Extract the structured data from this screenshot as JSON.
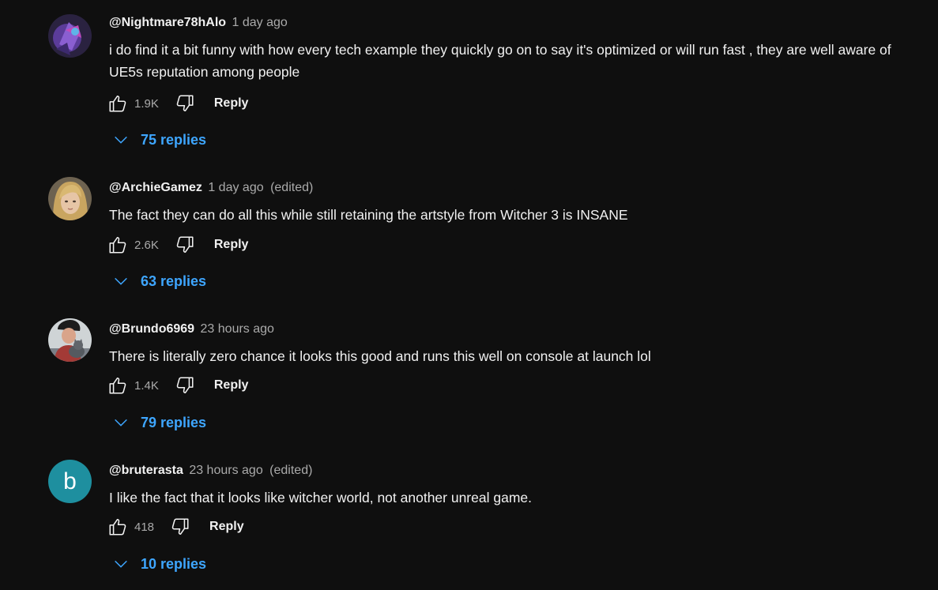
{
  "colors": {
    "background": "#0f0f0f",
    "primary_text": "#f1f1f1",
    "secondary_text": "#aaaaaa",
    "link_blue": "#3ea6ff",
    "letter_avatar_bg": "#1e8f9f"
  },
  "comments": [
    {
      "author": "@Nightmare78hAlo",
      "time": "1 day ago",
      "edited": "",
      "text": "i do find it a bit funny with how every tech example they quickly go on to say it's optimized or will run fast , they are well aware of UE5s reputation among people",
      "likes": "1.9K",
      "reply_label": "Reply",
      "replies_label": "75 replies",
      "avatar_icon": "purple-abstract-avatar-icon"
    },
    {
      "author": "@ArchieGamez",
      "time": "1 day ago",
      "edited": "(edited)",
      "text": "The fact they can do all this while still retaining the artstyle from Witcher 3 is INSANE",
      "likes": "2.6K",
      "reply_label": "Reply",
      "replies_label": "63 replies",
      "avatar_icon": "blonde-character-avatar-icon"
    },
    {
      "author": "@Brundo6969",
      "time": "23 hours ago",
      "edited": "",
      "text": "There is literally zero chance it looks this good and runs this well on console at launch lol",
      "likes": "1.4K",
      "reply_label": "Reply",
      "replies_label": "79 replies",
      "avatar_icon": "person-with-cat-avatar-icon"
    },
    {
      "author": "@bruterasta",
      "time": "23 hours ago",
      "edited": "(edited)",
      "text": "I like the fact that it looks like witcher world, not another unreal game.",
      "likes": "418",
      "reply_label": "Reply",
      "replies_label": "10 replies",
      "avatar_letter": "b"
    }
  ]
}
